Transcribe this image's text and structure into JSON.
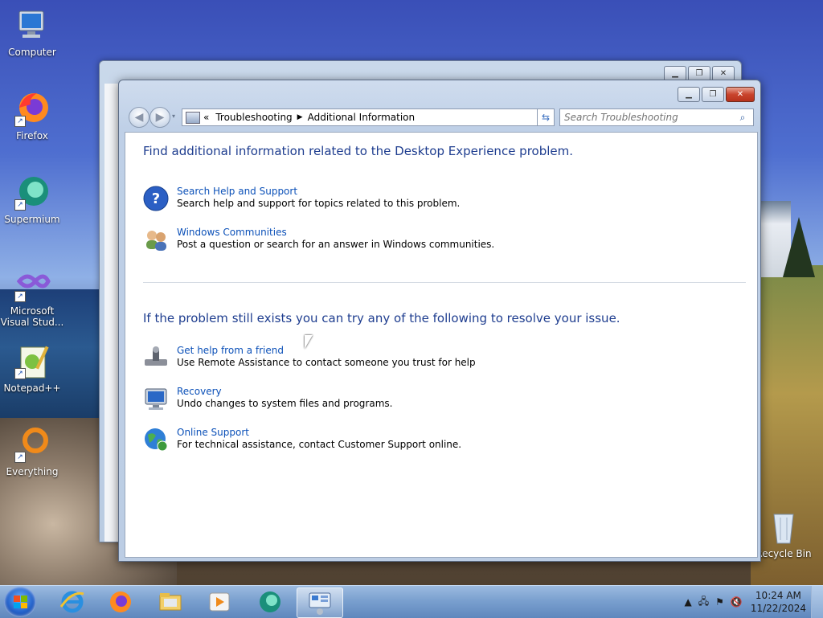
{
  "desktop": {
    "icons": [
      {
        "label": "Computer"
      },
      {
        "label": "Firefox"
      },
      {
        "label": "Supermium"
      },
      {
        "label": "Microsoft Visual Stud..."
      },
      {
        "label": "Notepad++"
      },
      {
        "label": "Everything"
      },
      {
        "label": "Recycle Bin"
      }
    ]
  },
  "window": {
    "breadcrumb_prefix": "«",
    "breadcrumb": [
      "Troubleshooting",
      "Additional Information"
    ],
    "search_placeholder": "Search Troubleshooting",
    "section1_heading": "Find additional information related to the Desktop Experience problem.",
    "section1_items": [
      {
        "title": "Search Help and Support",
        "desc": "Search help and support for topics related to this problem."
      },
      {
        "title": "Windows Communities",
        "desc": "Post a question or search for an answer in Windows communities."
      }
    ],
    "section2_heading": "If the problem still exists you can try any of the following to resolve your issue.",
    "section2_items": [
      {
        "title": "Get help from a friend",
        "desc": "Use Remote Assistance to contact someone you trust for help"
      },
      {
        "title": "Recovery",
        "desc": "Undo changes to system files and programs."
      },
      {
        "title": "Online Support",
        "desc": "For technical assistance, contact Customer Support online."
      }
    ]
  },
  "taskbar": {
    "time": "10:24 AM",
    "date": "11/22/2024"
  }
}
